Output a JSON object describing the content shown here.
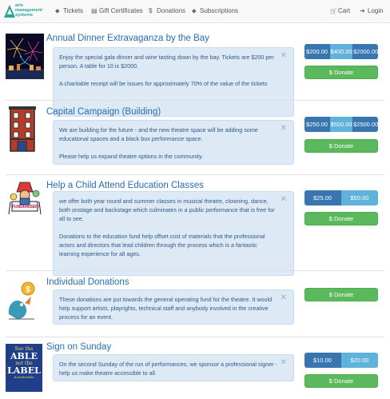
{
  "brand": {
    "logo_text_lines": [
      "arts",
      "management",
      "systems"
    ]
  },
  "nav": {
    "items": [
      {
        "icon": "tag-icon",
        "glyph": "⬥",
        "label": "Tickets"
      },
      {
        "icon": "gift-card-icon",
        "glyph": "▤",
        "label": "Gift Certificates"
      },
      {
        "icon": "dollar-icon",
        "glyph": "$",
        "label": "Donations"
      },
      {
        "icon": "tag-icon",
        "glyph": "⬥",
        "label": "Subscriptions"
      }
    ],
    "cart": {
      "icon": "cart-icon",
      "glyph": "🛒",
      "label": "Cart"
    },
    "login": {
      "icon": "login-icon",
      "glyph": "➜",
      "label": "Login"
    }
  },
  "cards": [
    {
      "title": "Annual Dinner Extravaganza by the Bay",
      "paragraphs": [
        "Enjoy the special gala dinner and wine tasting down by the bay. Tickets are $200 per person. A table for 10 is $2000.",
        "A charitable receipt will be issues for approximately 70% of the value of the tickets"
      ],
      "amounts": [
        "$200.00",
        "$400.00",
        "$2000.00"
      ],
      "donate_label": "$ Donate",
      "image": "fireworks"
    },
    {
      "title": "Capital Campaign (Building)",
      "paragraphs": [
        "We are building for the future - and the new theatre space will be adding some educational spaces and a black box performance space.",
        "Please help us expand theatre options in the community."
      ],
      "amounts": [
        "$250.00",
        "$500.00",
        "$2500.00"
      ],
      "donate_label": "$ Donate",
      "image": "building"
    },
    {
      "title": "Help a Child Attend Education Classes",
      "paragraphs": [
        "we offer both year round and summer classes in musical theatre, clowning, dance, both onstage and backstage which culminates in a public performance that is free for all to see.",
        "Donations to the education fund help offset cost of materials that the professional actors and directors that lead children through the process which is a fantastic learning experience for all ages."
      ],
      "amounts": [
        "$25.00",
        "$50.00"
      ],
      "donate_label": "$ Donate",
      "image": "fundraiser",
      "image_caption": "FUNDRAISER!"
    },
    {
      "title": "Individual Donations",
      "paragraphs": [
        "These donations are put towards the general operating fund for the theatre. It would help support artists, playrights, technical staff and anybody involved in the creative process for an event."
      ],
      "amounts": [],
      "donate_label": "$ Donate",
      "image": "coin-bird"
    },
    {
      "title": "Sign on Sunday",
      "paragraphs": [
        "On the second Sunday of the run of performances, we sponsor a professional signer - help us make theatre accessible to all."
      ],
      "amounts": [
        "$10.00",
        "$20.00"
      ],
      "donate_label": "$ Donate",
      "image": "see-the-able",
      "image_caption_lines": [
        "See the",
        "ABLE",
        "not the",
        "LABEL",
        "#seetheable"
      ]
    }
  ],
  "colors": {
    "title": "#2a6db3",
    "donate": "#5cb85c",
    "amount_dark": "#3875b1",
    "amount_light": "#5fb2dc",
    "body_bg": "#dde9f5"
  }
}
